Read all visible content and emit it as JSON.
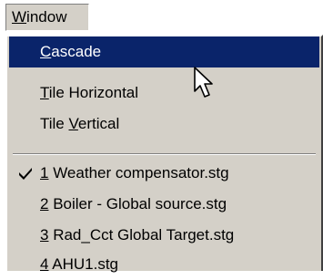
{
  "menubar": {
    "title": "Window",
    "accel": "W",
    "rest": "indow"
  },
  "menu": {
    "items": [
      {
        "accel": "C",
        "rest": "ascade",
        "pre": ""
      },
      {
        "accel": "T",
        "rest": "ile Horizontal",
        "pre": ""
      },
      {
        "accel": "V",
        "rest": "ertical",
        "pre": "Tile "
      }
    ],
    "windows": [
      {
        "accel": "1",
        "rest": " Weather compensator.stg",
        "checked": true
      },
      {
        "accel": "2",
        "rest": " Boiler - Global source.stg",
        "checked": false
      },
      {
        "accel": "3",
        "rest": " Rad_Cct Global Target.stg",
        "checked": false
      },
      {
        "accel": "4",
        "rest": " AHU1.stg",
        "checked": false
      }
    ]
  },
  "colors": {
    "menu_bg": "#d4d0c8",
    "highlight": "#0a246a",
    "highlight_text": "#ffffff"
  },
  "icons": {
    "check": "check-icon",
    "cursor": "mouse-pointer-icon"
  }
}
